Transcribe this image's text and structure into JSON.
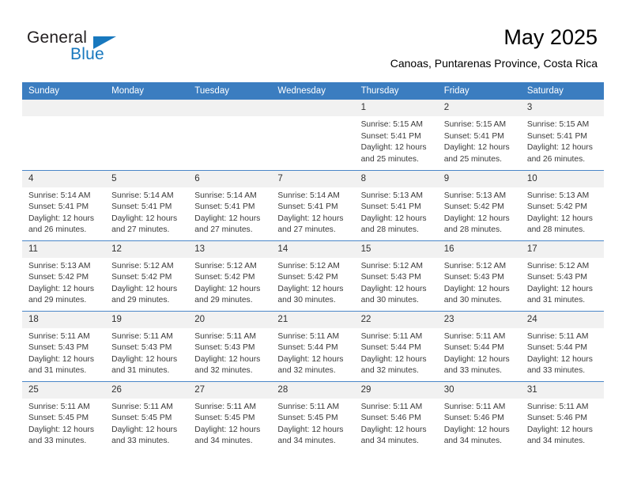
{
  "brand": {
    "name_part1": "General",
    "name_part2": "Blue",
    "accent_color": "#1878be"
  },
  "header": {
    "title": "May 2025",
    "location": "Canoas, Puntarenas Province, Costa Rica"
  },
  "theme": {
    "header_row_bg": "#3b7dc0",
    "daynum_bg": "#f1f1f1",
    "grid_line": "#4a86c8",
    "text": "#3a3a3a"
  },
  "weekday_headers": [
    "Sunday",
    "Monday",
    "Tuesday",
    "Wednesday",
    "Thursday",
    "Friday",
    "Saturday"
  ],
  "labels": {
    "sunrise_prefix": "Sunrise:",
    "sunset_prefix": "Sunset:",
    "daylight_prefix": "Daylight:"
  },
  "weeks": [
    [
      {
        "day": "",
        "empty": true
      },
      {
        "day": "",
        "empty": true
      },
      {
        "day": "",
        "empty": true
      },
      {
        "day": "",
        "empty": true
      },
      {
        "day": "1",
        "sunrise": "Sunrise: 5:15 AM",
        "sunset": "Sunset: 5:41 PM",
        "daylight_line1": "Daylight: 12 hours",
        "daylight_line2": "and 25 minutes."
      },
      {
        "day": "2",
        "sunrise": "Sunrise: 5:15 AM",
        "sunset": "Sunset: 5:41 PM",
        "daylight_line1": "Daylight: 12 hours",
        "daylight_line2": "and 25 minutes."
      },
      {
        "day": "3",
        "sunrise": "Sunrise: 5:15 AM",
        "sunset": "Sunset: 5:41 PM",
        "daylight_line1": "Daylight: 12 hours",
        "daylight_line2": "and 26 minutes."
      }
    ],
    [
      {
        "day": "4",
        "sunrise": "Sunrise: 5:14 AM",
        "sunset": "Sunset: 5:41 PM",
        "daylight_line1": "Daylight: 12 hours",
        "daylight_line2": "and 26 minutes."
      },
      {
        "day": "5",
        "sunrise": "Sunrise: 5:14 AM",
        "sunset": "Sunset: 5:41 PM",
        "daylight_line1": "Daylight: 12 hours",
        "daylight_line2": "and 27 minutes."
      },
      {
        "day": "6",
        "sunrise": "Sunrise: 5:14 AM",
        "sunset": "Sunset: 5:41 PM",
        "daylight_line1": "Daylight: 12 hours",
        "daylight_line2": "and 27 minutes."
      },
      {
        "day": "7",
        "sunrise": "Sunrise: 5:14 AM",
        "sunset": "Sunset: 5:41 PM",
        "daylight_line1": "Daylight: 12 hours",
        "daylight_line2": "and 27 minutes."
      },
      {
        "day": "8",
        "sunrise": "Sunrise: 5:13 AM",
        "sunset": "Sunset: 5:41 PM",
        "daylight_line1": "Daylight: 12 hours",
        "daylight_line2": "and 28 minutes."
      },
      {
        "day": "9",
        "sunrise": "Sunrise: 5:13 AM",
        "sunset": "Sunset: 5:42 PM",
        "daylight_line1": "Daylight: 12 hours",
        "daylight_line2": "and 28 minutes."
      },
      {
        "day": "10",
        "sunrise": "Sunrise: 5:13 AM",
        "sunset": "Sunset: 5:42 PM",
        "daylight_line1": "Daylight: 12 hours",
        "daylight_line2": "and 28 minutes."
      }
    ],
    [
      {
        "day": "11",
        "sunrise": "Sunrise: 5:13 AM",
        "sunset": "Sunset: 5:42 PM",
        "daylight_line1": "Daylight: 12 hours",
        "daylight_line2": "and 29 minutes."
      },
      {
        "day": "12",
        "sunrise": "Sunrise: 5:12 AM",
        "sunset": "Sunset: 5:42 PM",
        "daylight_line1": "Daylight: 12 hours",
        "daylight_line2": "and 29 minutes."
      },
      {
        "day": "13",
        "sunrise": "Sunrise: 5:12 AM",
        "sunset": "Sunset: 5:42 PM",
        "daylight_line1": "Daylight: 12 hours",
        "daylight_line2": "and 29 minutes."
      },
      {
        "day": "14",
        "sunrise": "Sunrise: 5:12 AM",
        "sunset": "Sunset: 5:42 PM",
        "daylight_line1": "Daylight: 12 hours",
        "daylight_line2": "and 30 minutes."
      },
      {
        "day": "15",
        "sunrise": "Sunrise: 5:12 AM",
        "sunset": "Sunset: 5:43 PM",
        "daylight_line1": "Daylight: 12 hours",
        "daylight_line2": "and 30 minutes."
      },
      {
        "day": "16",
        "sunrise": "Sunrise: 5:12 AM",
        "sunset": "Sunset: 5:43 PM",
        "daylight_line1": "Daylight: 12 hours",
        "daylight_line2": "and 30 minutes."
      },
      {
        "day": "17",
        "sunrise": "Sunrise: 5:12 AM",
        "sunset": "Sunset: 5:43 PM",
        "daylight_line1": "Daylight: 12 hours",
        "daylight_line2": "and 31 minutes."
      }
    ],
    [
      {
        "day": "18",
        "sunrise": "Sunrise: 5:11 AM",
        "sunset": "Sunset: 5:43 PM",
        "daylight_line1": "Daylight: 12 hours",
        "daylight_line2": "and 31 minutes."
      },
      {
        "day": "19",
        "sunrise": "Sunrise: 5:11 AM",
        "sunset": "Sunset: 5:43 PM",
        "daylight_line1": "Daylight: 12 hours",
        "daylight_line2": "and 31 minutes."
      },
      {
        "day": "20",
        "sunrise": "Sunrise: 5:11 AM",
        "sunset": "Sunset: 5:43 PM",
        "daylight_line1": "Daylight: 12 hours",
        "daylight_line2": "and 32 minutes."
      },
      {
        "day": "21",
        "sunrise": "Sunrise: 5:11 AM",
        "sunset": "Sunset: 5:44 PM",
        "daylight_line1": "Daylight: 12 hours",
        "daylight_line2": "and 32 minutes."
      },
      {
        "day": "22",
        "sunrise": "Sunrise: 5:11 AM",
        "sunset": "Sunset: 5:44 PM",
        "daylight_line1": "Daylight: 12 hours",
        "daylight_line2": "and 32 minutes."
      },
      {
        "day": "23",
        "sunrise": "Sunrise: 5:11 AM",
        "sunset": "Sunset: 5:44 PM",
        "daylight_line1": "Daylight: 12 hours",
        "daylight_line2": "and 33 minutes."
      },
      {
        "day": "24",
        "sunrise": "Sunrise: 5:11 AM",
        "sunset": "Sunset: 5:44 PM",
        "daylight_line1": "Daylight: 12 hours",
        "daylight_line2": "and 33 minutes."
      }
    ],
    [
      {
        "day": "25",
        "sunrise": "Sunrise: 5:11 AM",
        "sunset": "Sunset: 5:45 PM",
        "daylight_line1": "Daylight: 12 hours",
        "daylight_line2": "and 33 minutes."
      },
      {
        "day": "26",
        "sunrise": "Sunrise: 5:11 AM",
        "sunset": "Sunset: 5:45 PM",
        "daylight_line1": "Daylight: 12 hours",
        "daylight_line2": "and 33 minutes."
      },
      {
        "day": "27",
        "sunrise": "Sunrise: 5:11 AM",
        "sunset": "Sunset: 5:45 PM",
        "daylight_line1": "Daylight: 12 hours",
        "daylight_line2": "and 34 minutes."
      },
      {
        "day": "28",
        "sunrise": "Sunrise: 5:11 AM",
        "sunset": "Sunset: 5:45 PM",
        "daylight_line1": "Daylight: 12 hours",
        "daylight_line2": "and 34 minutes."
      },
      {
        "day": "29",
        "sunrise": "Sunrise: 5:11 AM",
        "sunset": "Sunset: 5:46 PM",
        "daylight_line1": "Daylight: 12 hours",
        "daylight_line2": "and 34 minutes."
      },
      {
        "day": "30",
        "sunrise": "Sunrise: 5:11 AM",
        "sunset": "Sunset: 5:46 PM",
        "daylight_line1": "Daylight: 12 hours",
        "daylight_line2": "and 34 minutes."
      },
      {
        "day": "31",
        "sunrise": "Sunrise: 5:11 AM",
        "sunset": "Sunset: 5:46 PM",
        "daylight_line1": "Daylight: 12 hours",
        "daylight_line2": "and 34 minutes."
      }
    ]
  ]
}
